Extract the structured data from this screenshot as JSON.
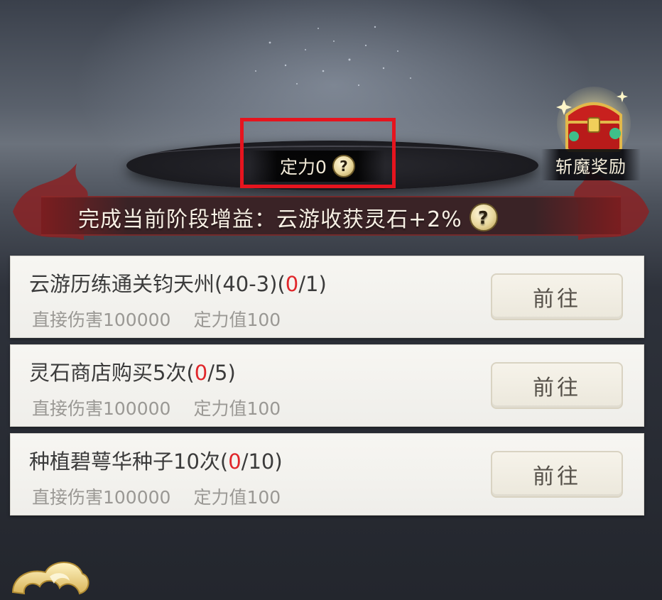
{
  "focus": {
    "label": "定力",
    "value": "0",
    "help": "?"
  },
  "reward": {
    "label": "斩魔奖励"
  },
  "bonus": {
    "text": "完成当前阶段增益：云游收获灵石+2%",
    "help": "?"
  },
  "tasks": [
    {
      "title": "云游历练通关钧天州(40-3)",
      "progress_open": "(",
      "progress_current": "0",
      "progress_total": "/1)",
      "damage": "直接伤害100000",
      "focus_gain": "定力值100",
      "button": "前往"
    },
    {
      "title": "灵石商店购买5次",
      "progress_open": "(",
      "progress_current": "0",
      "progress_total": "/5)",
      "damage": "直接伤害100000",
      "focus_gain": "定力值100",
      "button": "前往"
    },
    {
      "title": "种植碧萼华种子10次",
      "progress_open": "(",
      "progress_current": "0",
      "progress_total": "/10)",
      "damage": "直接伤害100000",
      "focus_gain": "定力值100",
      "button": "前往"
    }
  ],
  "colors": {
    "highlight": "#e6141e",
    "progress_red": "#e0262a",
    "banner_red": "#7a1c1e",
    "gold": "#e8d79c"
  },
  "icons": {
    "help": "question-mark-icon",
    "chest": "treasure-chest-icon",
    "cloud": "auspicious-cloud-icon"
  }
}
